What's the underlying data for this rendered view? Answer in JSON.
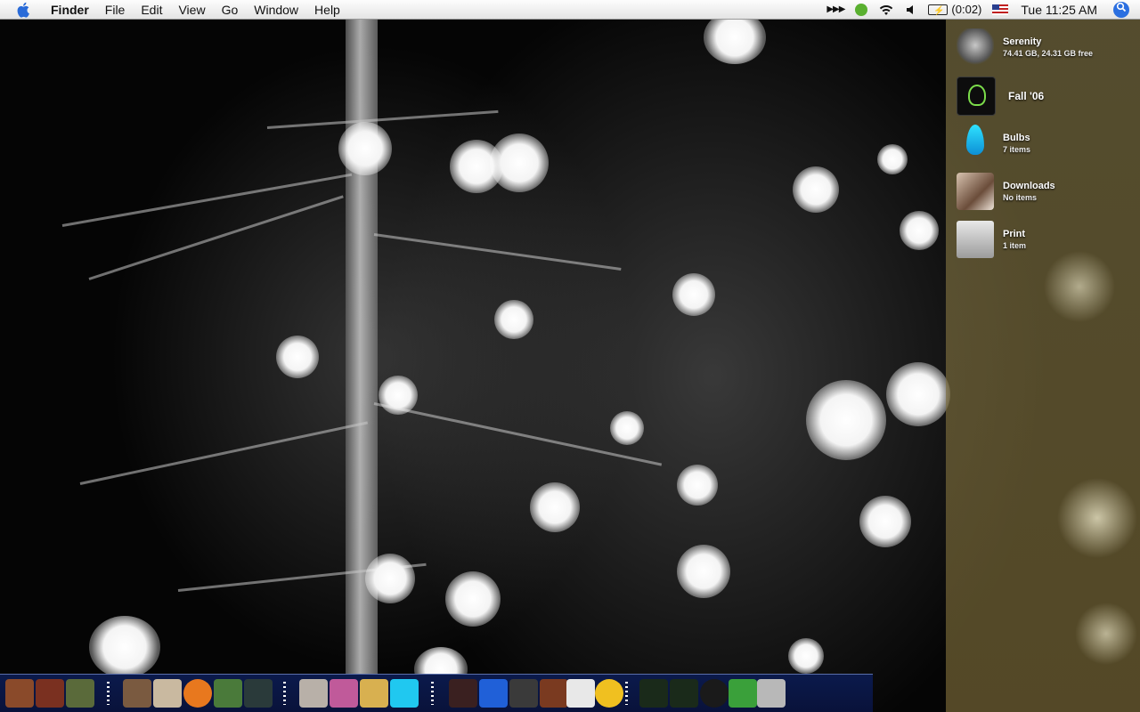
{
  "menubar": {
    "apple_icon": "apple-logo-icon",
    "app_name": "Finder",
    "menus": [
      "File",
      "Edit",
      "View",
      "Go",
      "Window",
      "Help"
    ],
    "status": {
      "battery_time": "(0:02)",
      "clock": "Tue 11:25 AM"
    }
  },
  "desktop": {
    "items": [
      {
        "title": "Serenity",
        "subtitle": "74.41 GB, 24.31 GB free",
        "icon": "hard-drive-icon"
      },
      {
        "title": "Fall '06",
        "subtitle": "",
        "icon": "folder-alias-icon"
      },
      {
        "title": "Bulbs",
        "subtitle": "7 items",
        "icon": "bulb-folder-icon"
      },
      {
        "title": "Downloads",
        "subtitle": "No items",
        "icon": "downloads-folder-icon"
      },
      {
        "title": "Print",
        "subtitle": "1 item",
        "icon": "printer-icon"
      }
    ]
  },
  "dock": {
    "items": [
      {
        "name": "person-1-icon",
        "color": "#8a4a2a"
      },
      {
        "name": "person-2-icon",
        "color": "#7a3020"
      },
      {
        "name": "person-3-icon",
        "color": "#5a6a3a"
      },
      {
        "name": "person-4-icon",
        "color": "#7a5a40"
      },
      {
        "name": "k-badge-icon",
        "color": "#c9b9a0"
      },
      {
        "name": "firefox-icon",
        "color": "#e8781e"
      },
      {
        "name": "character-icon",
        "color": "#4a7a3a"
      },
      {
        "name": "photo-app-icon",
        "color": "#2a3a3a"
      },
      {
        "name": "character-2-icon",
        "color": "#b8b0a8"
      },
      {
        "name": "color-pattern-icon",
        "color": "#c05a9a"
      },
      {
        "name": "image-capture-icon",
        "color": "#d8b050"
      },
      {
        "name": "bulb-icon",
        "color": "#20c8f0"
      },
      {
        "name": "person-5-icon",
        "color": "#3a2020"
      },
      {
        "name": "blue-label-icon",
        "color": "#2060d8"
      },
      {
        "name": "music-icon",
        "color": "#3a3a3a"
      },
      {
        "name": "person-6-icon",
        "color": "#7a3a20"
      },
      {
        "name": "document-j-icon",
        "color": "#e8e8e8"
      },
      {
        "name": "fw-icon",
        "color": "#f0c020"
      },
      {
        "name": "lightbulb-app-icon",
        "color": "#1a2a1a"
      },
      {
        "name": "running-man-icon",
        "color": "#1a2a1a"
      },
      {
        "name": "dashboard-icon",
        "color": "#1a1a1a"
      },
      {
        "name": "home-icon",
        "color": "#3aa03a"
      },
      {
        "name": "trash-icon",
        "color": "#b8b8b8"
      }
    ]
  }
}
